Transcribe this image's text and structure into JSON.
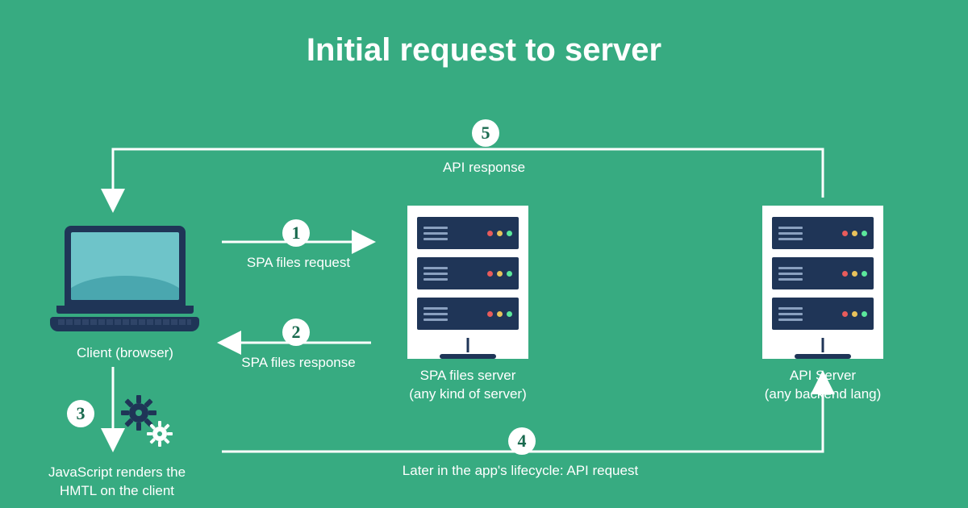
{
  "title": "Initial request to server",
  "nodes": {
    "client": {
      "label": "Client (browser)"
    },
    "spa_server": {
      "label_line1": "SPA files server",
      "label_line2": "(any kind of server)"
    },
    "api_server": {
      "label_line1": "API Server",
      "label_line2": "(any backend lang)"
    }
  },
  "steps": {
    "s1": {
      "num": "1",
      "label": "SPA files request"
    },
    "s2": {
      "num": "2",
      "label": "SPA files response"
    },
    "s3": {
      "num": "3",
      "label_line1": "JavaScript renders the",
      "label_line2": "HMTL on the client"
    },
    "s4": {
      "num": "4",
      "label": "Later in the app's lifecycle: API request"
    },
    "s5": {
      "num": "5",
      "label": "API response"
    }
  }
}
